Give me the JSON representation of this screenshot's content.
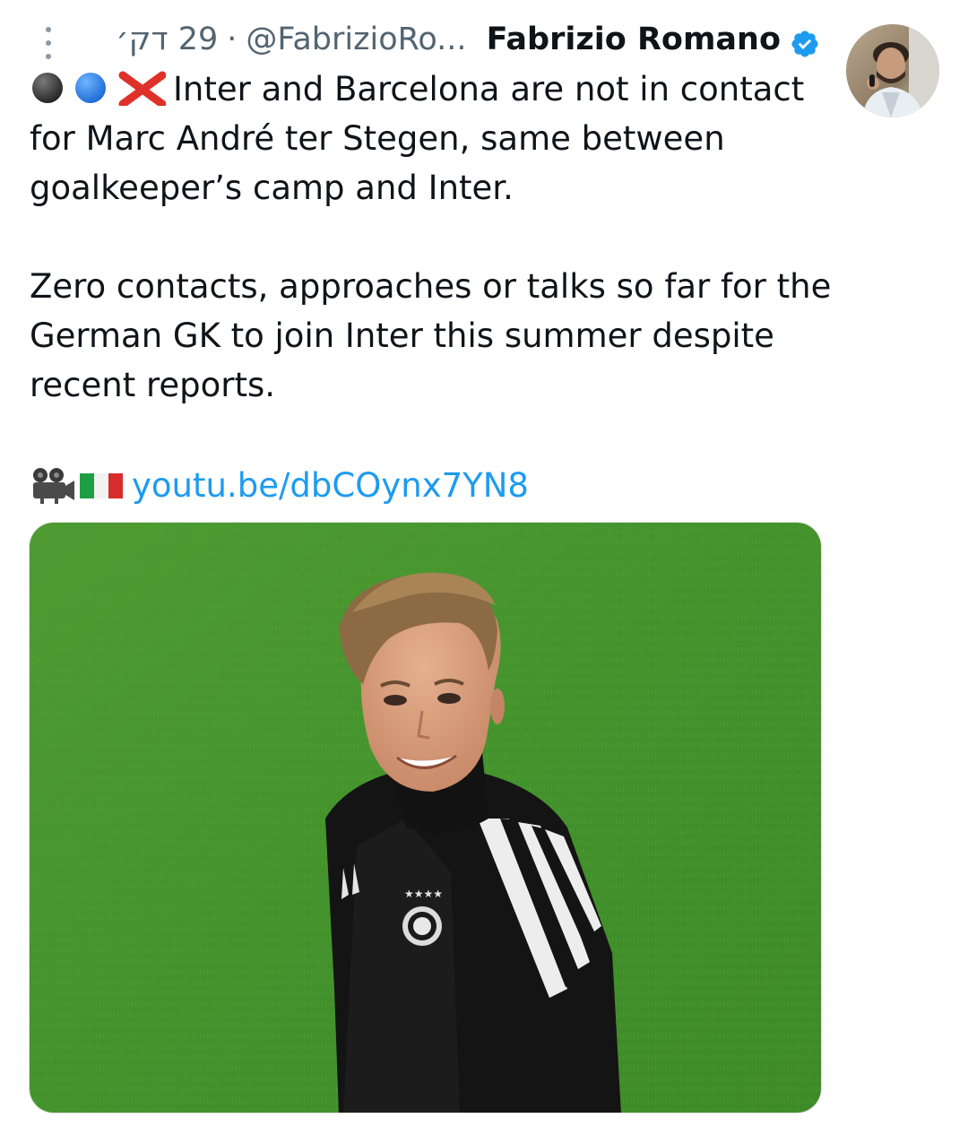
{
  "tweet": {
    "time": "29 דק׳",
    "separator": "·",
    "handle": "@FabrizioRo...",
    "display_name": "Fabrizio Romano",
    "verified": true,
    "emojis": [
      "black-circle",
      "blue-circle",
      "red-cross-mark"
    ],
    "text_line1": "Inter and Barcelona are not in contact for Marc André ter Stegen, same between goalkeeper’s camp and Inter.",
    "text_para2": "Zero contacts, approaches or talks so far for the German GK to join Inter this summer despite recent reports.",
    "link_emojis": [
      "movie-camera",
      "italy-flag"
    ],
    "link_text": "youtu.be/dbCOynx7YN8",
    "media_description_icon": "photo",
    "colors": {
      "link": "#1d9bf0",
      "secondary_text": "#536471",
      "verified": "#1d9bf0",
      "primary_text": "#0f1419"
    }
  }
}
